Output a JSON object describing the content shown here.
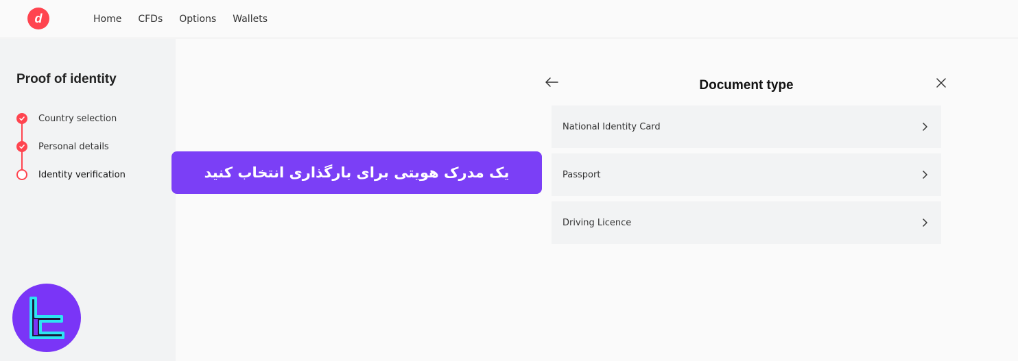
{
  "header": {
    "logo_letter": "d",
    "nav": [
      {
        "label": "Home"
      },
      {
        "label": "CFDs"
      },
      {
        "label": "Options"
      },
      {
        "label": "Wallets"
      }
    ]
  },
  "sidebar": {
    "title": "Proof of identity",
    "steps": [
      {
        "label": "Country selection",
        "state": "done"
      },
      {
        "label": "Personal details",
        "state": "done"
      },
      {
        "label": "Identity verification",
        "state": "current"
      }
    ]
  },
  "banner": {
    "text": "یک مدرک هویتی برای بارگذاری انتخاب کنید"
  },
  "dialog": {
    "title": "Document type",
    "documents": [
      {
        "label": "National Identity Card"
      },
      {
        "label": "Passport"
      },
      {
        "label": "Driving Licence"
      }
    ]
  },
  "colors": {
    "brand": "#ff444f",
    "banner": "#7b3ff6",
    "watermark": "#7a35f7",
    "watermark_accent": "#2de3f2"
  }
}
